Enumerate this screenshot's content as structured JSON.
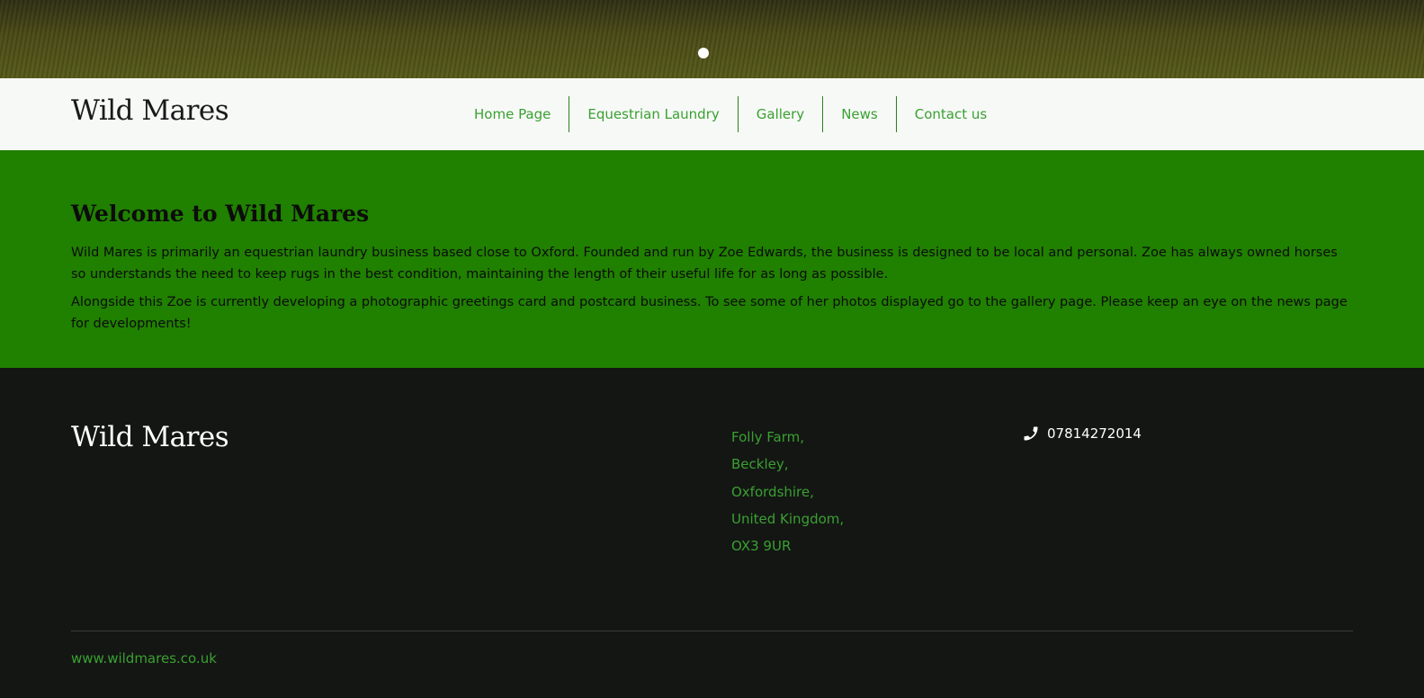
{
  "hero": {
    "slide_indicator": "slide-1-active"
  },
  "header": {
    "title": "Wild Mares",
    "nav": [
      {
        "label": "Home Page"
      },
      {
        "label": "Equestrian Laundry"
      },
      {
        "label": "Gallery"
      },
      {
        "label": "News"
      },
      {
        "label": "Contact us"
      }
    ]
  },
  "welcome": {
    "heading": "Welcome to Wild Mares",
    "paragraph1": "Wild Mares is primarily an equestrian laundry business based close to Oxford. Founded and run by Zoe Edwards, the business is designed to be local and personal. Zoe has always owned horses so understands the need to keep rugs in the best condition, maintaining the length of their useful life for as long as possible.",
    "paragraph2": "Alongside this Zoe is currently developing a photographic greetings card and postcard business. To see some of her photos displayed go to the gallery page. Please keep an eye on the news page for developments!"
  },
  "footer": {
    "title": "Wild Mares",
    "address": [
      "Folly Farm,",
      "Beckley,",
      "Oxfordshire,",
      "United Kingdom,",
      "OX3 9UR"
    ],
    "phone": "07814272014",
    "phone_icon": "phone-icon",
    "url": "www.wildmares.co.uk"
  },
  "colors": {
    "accent_green": "#3aa030",
    "welcome_bg": "#208000",
    "footer_bg": "#141614",
    "header_bg": "#f7f9f7"
  }
}
